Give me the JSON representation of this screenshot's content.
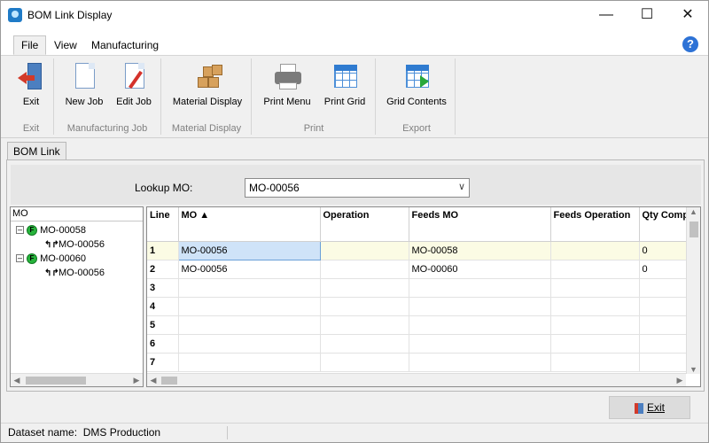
{
  "window": {
    "title": "BOM Link Display"
  },
  "menu": {
    "tabs": [
      "File",
      "View",
      "Manufacturing"
    ]
  },
  "ribbon": {
    "buttons": {
      "exit": "Exit",
      "new_job": "New Job",
      "edit_job": "Edit Job",
      "material_display": "Material Display",
      "print_menu": "Print Menu",
      "print_grid": "Print Grid",
      "grid_contents": "Grid Contents"
    },
    "groups": {
      "exit": "Exit",
      "manufacturing_job": "Manufacturing Job",
      "material_display": "Material Display",
      "print": "Print",
      "export": "Export"
    }
  },
  "content_tab": "BOM Link",
  "lookup": {
    "label": "Lookup MO:",
    "value": "MO-00056"
  },
  "tree": {
    "header": "MO",
    "nodes": [
      {
        "badge": "F",
        "label": "MO-00058",
        "child": "MO-00056"
      },
      {
        "badge": "F",
        "label": "MO-00060",
        "child": "MO-00056"
      }
    ]
  },
  "grid": {
    "columns": [
      "Line",
      "MO ▲",
      "Operation",
      "Feeds MO",
      "Feeds Operation",
      "Qty Comp"
    ],
    "rows": [
      {
        "line": "1",
        "mo": "MO-00056",
        "operation": "",
        "feeds_mo": "MO-00058",
        "feeds_operation": "",
        "qty": "0"
      },
      {
        "line": "2",
        "mo": "MO-00056",
        "operation": "",
        "feeds_mo": "MO-00060",
        "feeds_operation": "",
        "qty": "0"
      },
      {
        "line": "3",
        "mo": "",
        "operation": "",
        "feeds_mo": "",
        "feeds_operation": "",
        "qty": ""
      },
      {
        "line": "4",
        "mo": "",
        "operation": "",
        "feeds_mo": "",
        "feeds_operation": "",
        "qty": ""
      },
      {
        "line": "5",
        "mo": "",
        "operation": "",
        "feeds_mo": "",
        "feeds_operation": "",
        "qty": ""
      },
      {
        "line": "6",
        "mo": "",
        "operation": "",
        "feeds_mo": "",
        "feeds_operation": "",
        "qty": ""
      },
      {
        "line": "7",
        "mo": "",
        "operation": "",
        "feeds_mo": "",
        "feeds_operation": "",
        "qty": ""
      }
    ]
  },
  "footer": {
    "exit_label": "Exit"
  },
  "status": {
    "text": "Dataset name:  DMS Production"
  }
}
